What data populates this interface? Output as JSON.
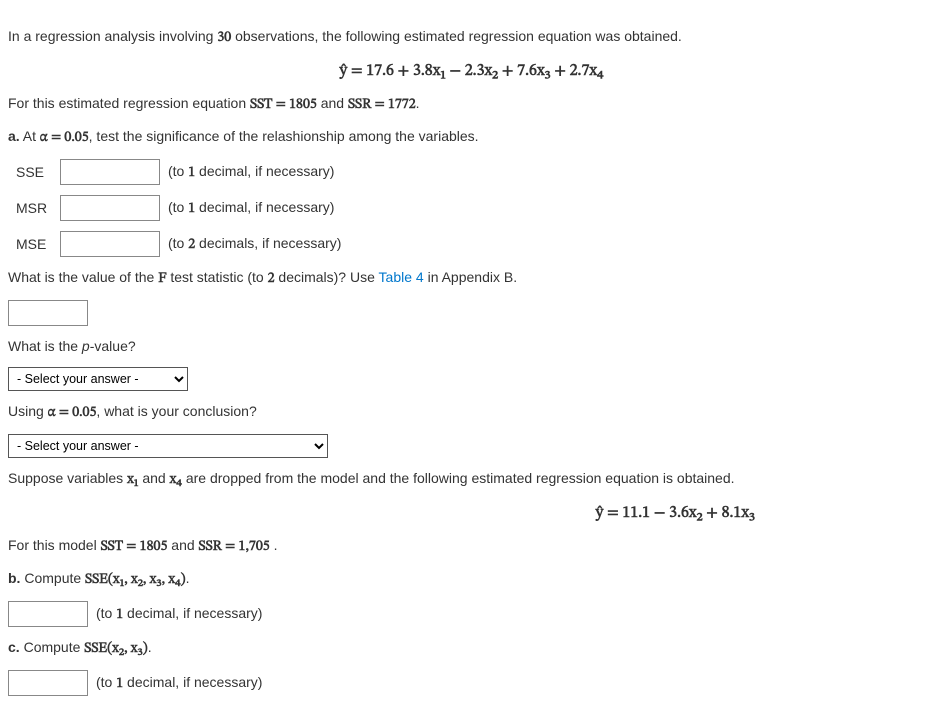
{
  "intro": {
    "prefix": "In a regression analysis involving ",
    "nobs": "30",
    "suffix": " observations, the following estimated regression equation was obtained."
  },
  "eq1": "ŷ = 17.6 + 3.8x₁ − 2.3x₂ + 7.6x₃ + 2.7x₄",
  "line2": {
    "t1": "For this estimated regression equation ",
    "sst": "SST = 1805",
    "t2": " and ",
    "ssr": "SSR = 1772",
    "t3": "."
  },
  "parta": {
    "label": "a.",
    "t1": " At ",
    "alpha": "α = 0.05",
    "t2": ", test the significance of the relashionship among the variables."
  },
  "fields": {
    "sse": {
      "label": "SSE",
      "hint": "(to 1 decimal, if necessary)",
      "value": ""
    },
    "msr": {
      "label": "MSR",
      "hint": "(to 1 decimal, if necessary)",
      "value": ""
    },
    "mse": {
      "label": "MSE",
      "hint": "(to 2 decimals, if necessary)",
      "value": ""
    }
  },
  "fstat": {
    "t1": "What is the value of the ",
    "F": "F",
    "t2": " test statistic (to ",
    "dec": "2",
    "t3": " decimals)? Use ",
    "link": "Table 4",
    "t4": " in Appendix B.",
    "value": ""
  },
  "pval": {
    "q": "What is the p-value?",
    "placeholder": "- Select your answer -"
  },
  "concl": {
    "t1": "Using ",
    "alpha": "α = 0.05",
    "t2": ", what is your conclusion?",
    "placeholder": "- Select your answer -"
  },
  "reduced": {
    "t1": "Suppose variables ",
    "x1": "x₁",
    "t2": " and ",
    "x4": "x₄",
    "t3": " are dropped from the model and the following estimated regression equation is obtained."
  },
  "eq2": "ŷ = 11.1 − 3.6x₂ + 8.1x₃",
  "line_reduced": {
    "t1": "For this model ",
    "sst": "SST = 1805",
    "t2": " and ",
    "ssr": "SSR = 1,705",
    "t3": " ."
  },
  "partb": {
    "label": "b.",
    "t1": " Compute ",
    "expr": "SSE(x₁, x₂, x₃, x₄)",
    "t2": ".",
    "hint": "(to 1 decimal, if necessary)",
    "value": ""
  },
  "partc": {
    "label": "c.",
    "t1": " Compute ",
    "expr": "SSE(x₂, x₃)",
    "t2": ".",
    "hint": "(to 1 decimal, if necessary)",
    "value": ""
  }
}
